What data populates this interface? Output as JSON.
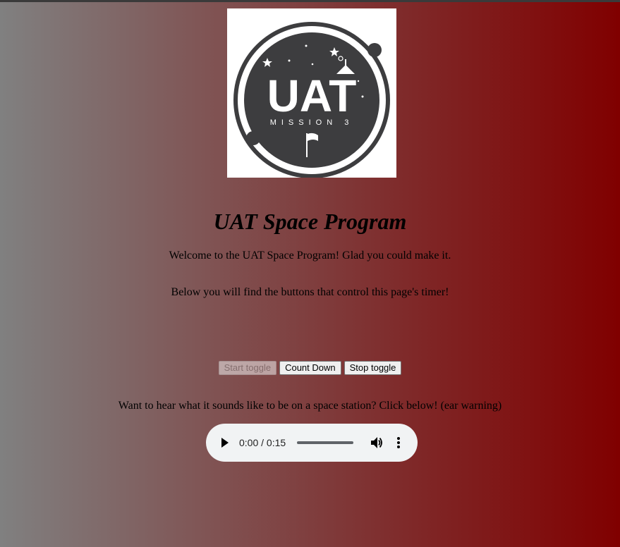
{
  "logo": {
    "title_text": "UAT",
    "subtitle_text": "MISSION 3",
    "colors": {
      "badge": "#3d3d3f",
      "background": "#ffffff"
    }
  },
  "page": {
    "heading": "UAT Space Program",
    "welcome": "Welcome to the UAT Space Program! Glad you could make it.",
    "instructions": "Below you will find the buttons that control this page's timer!",
    "audio_prompt": "Want to hear what it sounds like to be on a space station? Click below! (ear warning)"
  },
  "controls": {
    "start_label": "Start toggle",
    "start_disabled": true,
    "countdown_label": "Count Down",
    "stop_label": "Stop toggle"
  },
  "audio_player": {
    "time_display": "0:00 / 0:15",
    "progress": 0,
    "icons": [
      "play-icon",
      "volume-icon",
      "more-options-icon"
    ]
  },
  "colors": {
    "gradient_start": "#808080",
    "gradient_end": "#800000"
  }
}
